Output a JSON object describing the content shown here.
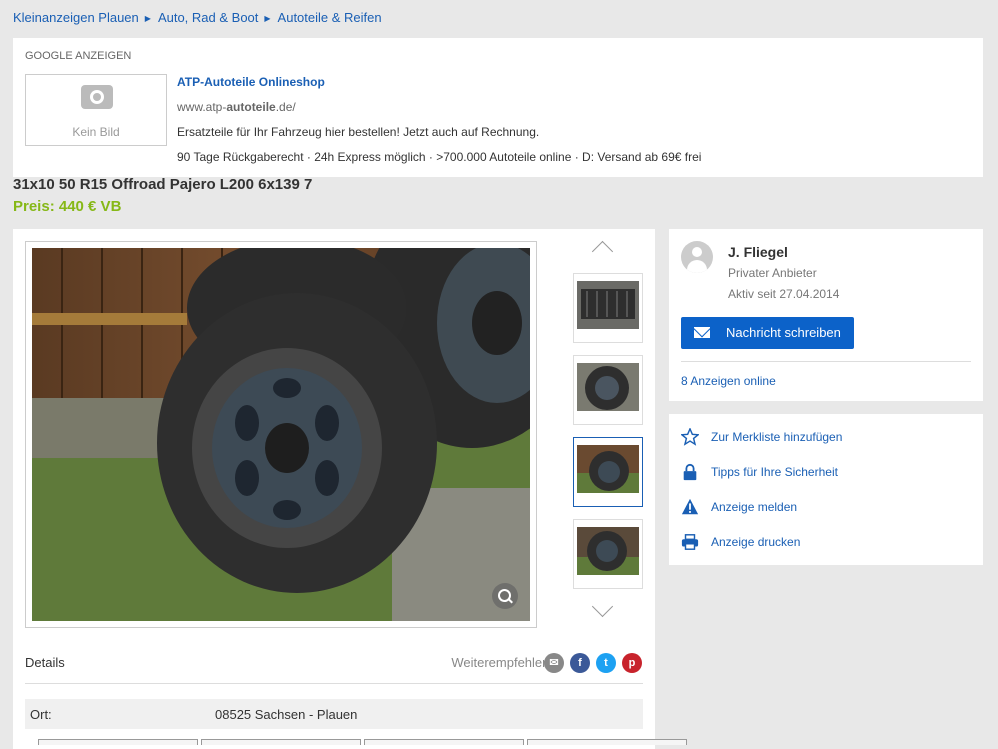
{
  "breadcrumb": [
    "Kleinanzeigen Plauen",
    "Auto, Rad & Boot",
    "Autoteile & Reifen"
  ],
  "ad": {
    "label": "GOOGLE ANZEIGEN",
    "noimg_text": "Kein Bild",
    "title_prefix": "ATP-",
    "title_bold": "Autoteile",
    "title_suffix": " Onlineshop",
    "url_prefix": "www.atp-",
    "url_bold": "autoteile",
    "url_suffix": ".de/",
    "line1": "Ersatzteile für Ihr Fahrzeug hier bestellen! Jetzt auch auf Rechnung.",
    "line2": "90 Tage Rückgaberecht · 24h Express möglich · >700.000 Autoteile online · D: Versand ab 69€ frei"
  },
  "listing": {
    "title": "31x10 50 R15 Offroad Pajero L200 6x139 7",
    "price": "Preis: 440 € VB"
  },
  "details": {
    "label": "Details",
    "share_label": "Weiterempfehlen:",
    "location_key": "Ort:",
    "location_value": "08525 Sachsen - Plauen"
  },
  "seller": {
    "name": "J. Fliegel",
    "type": "Privater Anbieter",
    "since": "Aktiv seit 27.04.2014",
    "message_button": "Nachricht schreiben",
    "ads_online": "8 Anzeigen online"
  },
  "actions": [
    {
      "label": "Zur Merkliste hinzufügen",
      "icon": "star-icon"
    },
    {
      "label": "Tipps für Ihre Sicherheit",
      "icon": "lock-icon"
    },
    {
      "label": "Anzeige melden",
      "icon": "warning-icon"
    },
    {
      "label": "Anzeige drucken",
      "icon": "printer-icon"
    }
  ],
  "colors": {
    "accent": "#1a5fb4",
    "price": "#86b817",
    "button": "#0c62c9"
  }
}
